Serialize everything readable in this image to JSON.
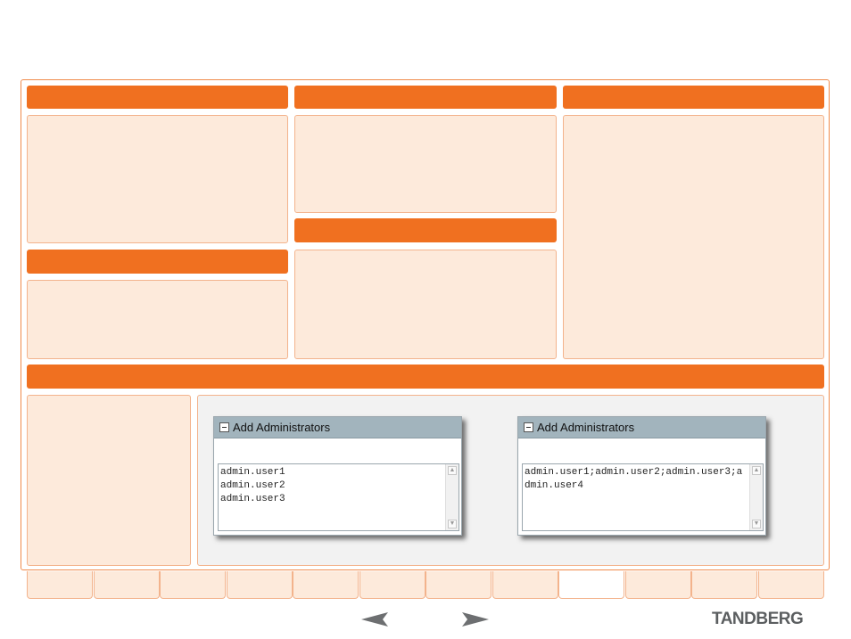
{
  "dialogs": [
    {
      "title": "Add Administrators",
      "text": "admin.user1\nadmin.user2\nadmin.user3",
      "scroll_up": "▲",
      "scroll_down": "▼"
    },
    {
      "title": "Add Administrators",
      "text": "admin.user1;admin.user2;admin.user3;admin.user4",
      "scroll_up": "▲",
      "scroll_down": "▼"
    }
  ],
  "navigation": {
    "prev_icon": "arrow-left-icon",
    "next_icon": "arrow-right-icon"
  },
  "tabs": {
    "count": 12,
    "active_index": 8
  },
  "brand": {
    "logo_text": "TANDBERG"
  },
  "colors": {
    "accent": "#f07020",
    "pane_bg": "#fdeadb",
    "dialog_header": "#a2b4bd",
    "logo": "#5b5e60"
  }
}
